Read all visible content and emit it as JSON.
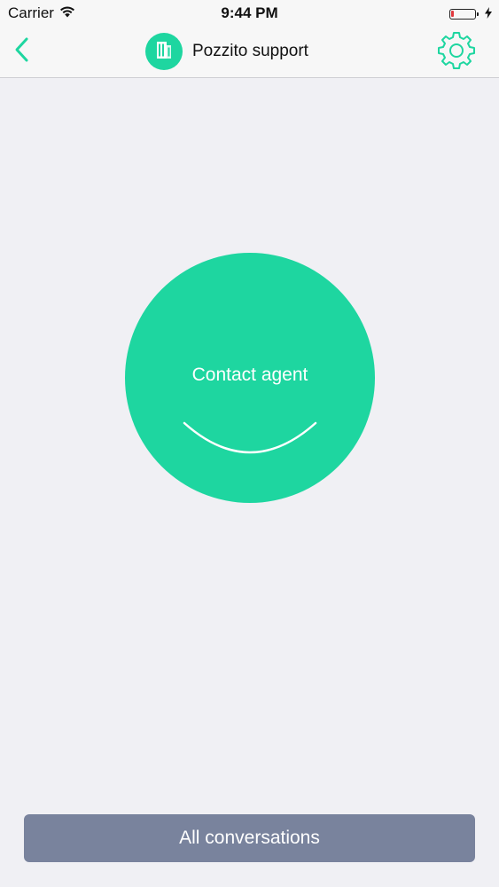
{
  "status_bar": {
    "carrier": "Carrier",
    "time": "9:44 PM",
    "battery_level": 0.12,
    "charging": true,
    "icons": [
      "wifi-icon",
      "battery-icon",
      "charging-bolt-icon"
    ]
  },
  "nav": {
    "title": "Pozzito support",
    "back_icon": "chevron-left-icon",
    "avatar_icon": "building-icon",
    "settings_icon": "gear-icon"
  },
  "main": {
    "contact_label": "Contact agent",
    "smile_icon": "smile-icon"
  },
  "footer": {
    "all_conversations_label": "All conversations"
  },
  "colors": {
    "accent": "#1ed6a0",
    "footer_button": "#79839d",
    "background": "#f0f0f4",
    "battery_low": "#e0393e"
  }
}
